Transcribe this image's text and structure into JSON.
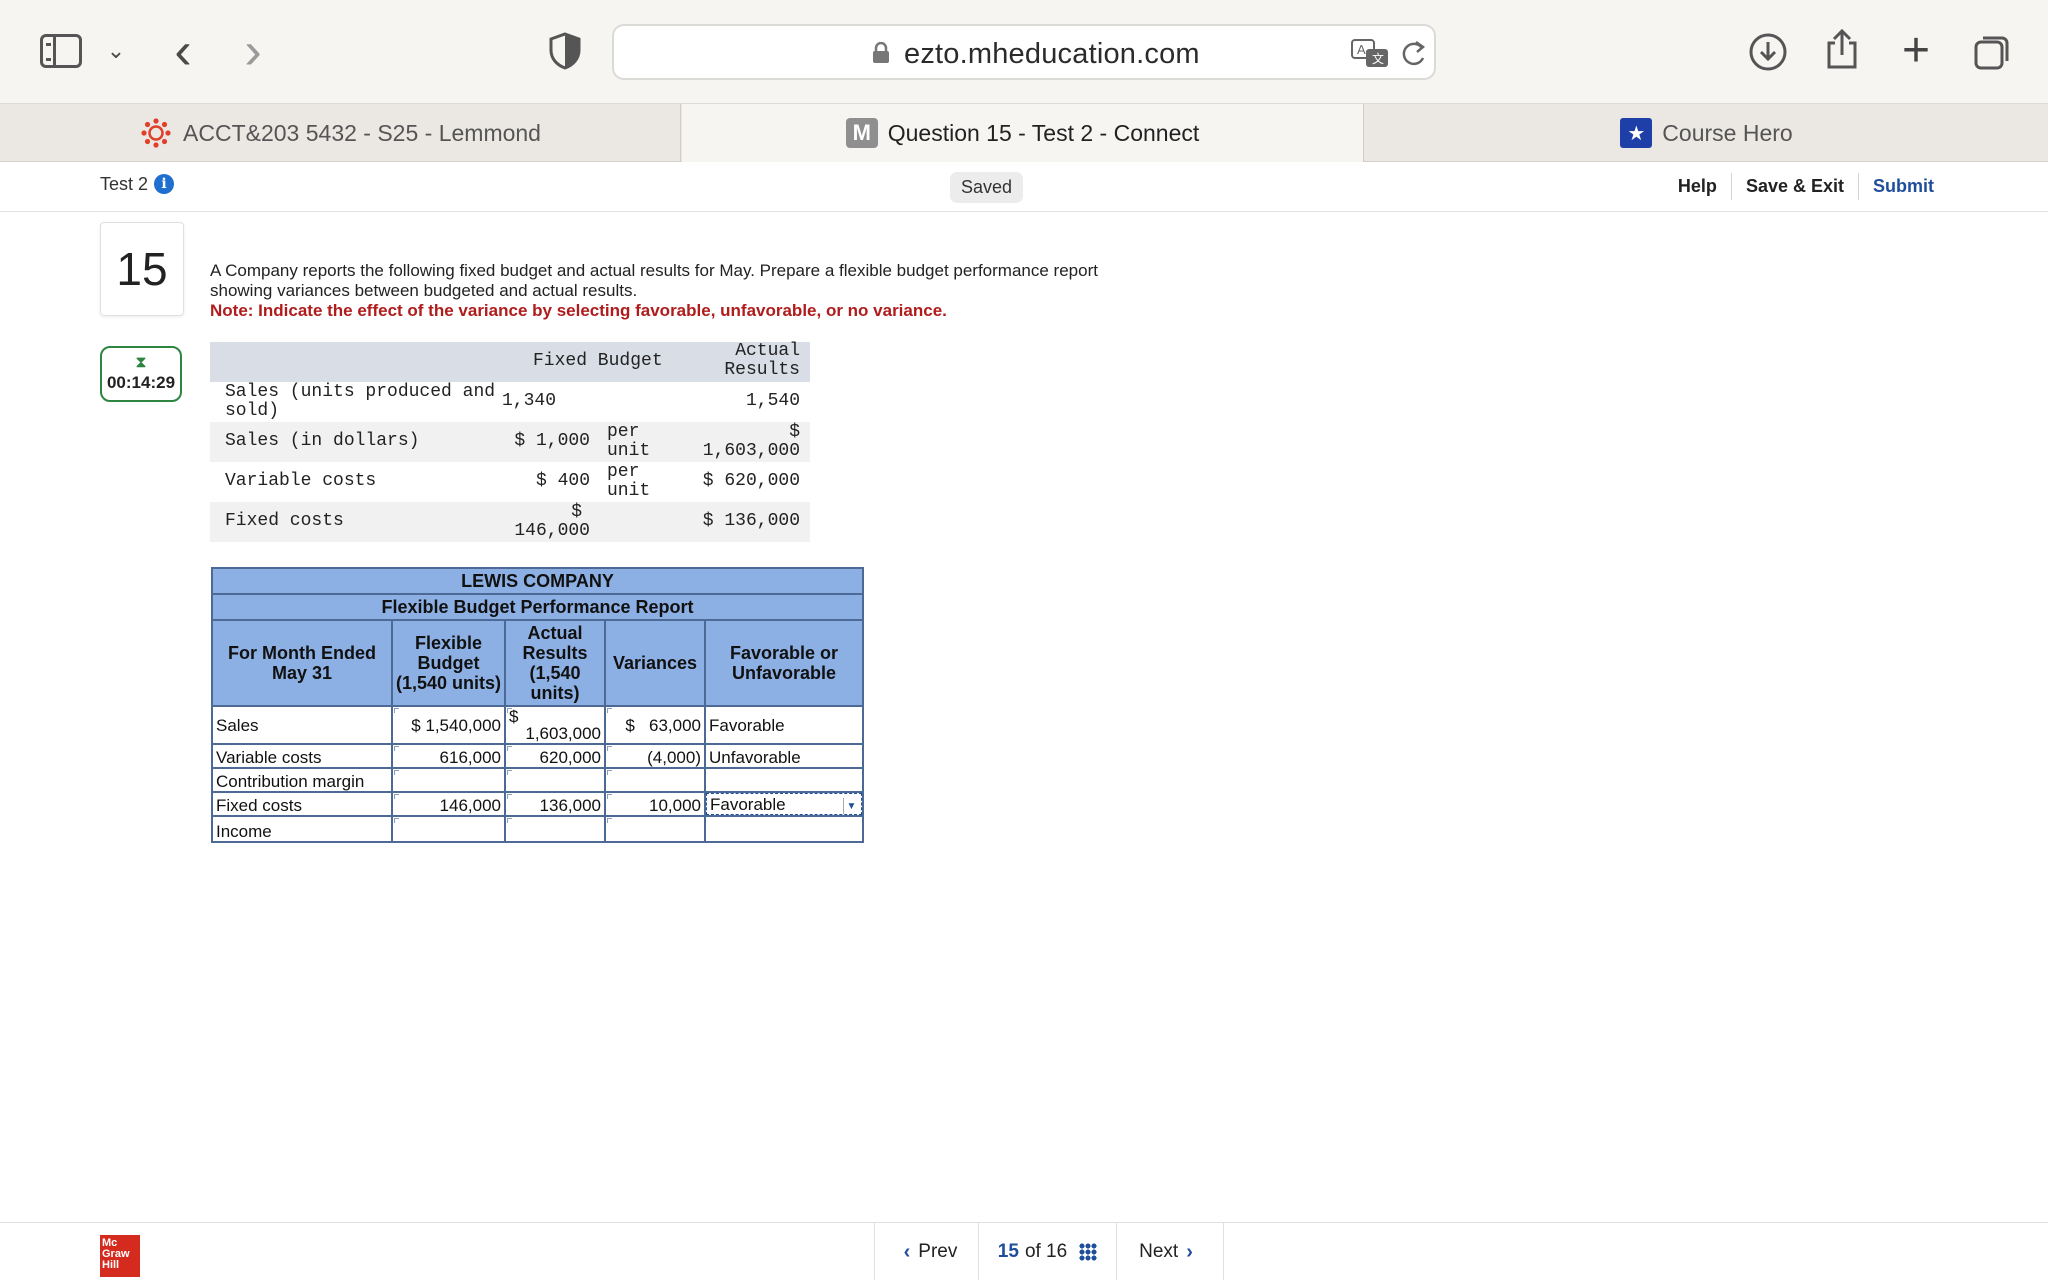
{
  "browser": {
    "url": "ezto.mheducation.com",
    "tabs": [
      {
        "label": "ACCT&203 5432 - S25 - Lemmond"
      },
      {
        "label": "Question 15 - Test 2 - Connect",
        "fav": "M"
      },
      {
        "label": "Course Hero"
      }
    ]
  },
  "header": {
    "test_label": "Test 2",
    "info": "i",
    "saved": "Saved",
    "help": "Help",
    "save_exit": "Save & Exit",
    "submit": "Submit"
  },
  "question": {
    "number": "15",
    "timer": "00:14:29",
    "prompt_line1": "A Company reports the following fixed budget and actual results for May. Prepare a flexible budget performance report",
    "prompt_line2": "showing variances between budgeted and actual results.",
    "note": "Note: Indicate the effect of the variance by selecting favorable, unfavorable, or no variance."
  },
  "given": {
    "headers": {
      "fixed": "Fixed Budget",
      "actual_1": "Actual",
      "actual_2": "Results"
    },
    "rows": [
      {
        "label_1": "Sales (units produced and",
        "label_2": "sold)",
        "fixed": "1,340",
        "per_1": "",
        "per_2": "",
        "actual_1": "",
        "actual_2": "1,540"
      },
      {
        "label_1": "Sales (in dollars)",
        "label_2": "",
        "fixed": "$ 1,000",
        "per_1": "per",
        "per_2": "unit",
        "actual_1": "$",
        "actual_2": "1,603,000"
      },
      {
        "label_1": "Variable costs",
        "label_2": "",
        "fixed": "$ 400",
        "per_1": "per",
        "per_2": "unit",
        "actual_1": "",
        "actual_2": "$ 620,000"
      },
      {
        "label_1": "Fixed costs",
        "label_2": "",
        "fixed_1": "$",
        "fixed": "146,000",
        "per_1": "",
        "per_2": "",
        "actual_1": "",
        "actual_2": "$ 136,000"
      }
    ]
  },
  "report": {
    "company": "LEWIS COMPANY",
    "title": "Flexible Budget Performance Report",
    "col_month": "For Month Ended May 31",
    "col_flex": "Flexible Budget (1,540 units)",
    "col_actual": "Actual Results (1,540 units)",
    "col_var": "Variances",
    "col_fav": "Favorable or Unfavorable",
    "rows": [
      {
        "label": "Sales",
        "flex": "$ 1,540,000",
        "actual_dollar": "$",
        "actual": "1,603,000",
        "var": "$   63,000",
        "fav": "Favorable"
      },
      {
        "label": "Variable costs",
        "flex": "616,000",
        "actual": "620,000",
        "var": "(4,000)",
        "fav": "Unfavorable"
      },
      {
        "label": "Contribution margin",
        "flex": "",
        "actual": "",
        "var": "",
        "fav": ""
      },
      {
        "label": "Fixed costs",
        "flex": "146,000",
        "actual": "136,000",
        "var": "10,000",
        "fav": "Favorable"
      },
      {
        "label": "Income",
        "flex": "",
        "actual": "",
        "var": "",
        "fav": ""
      }
    ]
  },
  "footer": {
    "prev": "Prev",
    "current": "15",
    "of_total": "of 16",
    "next": "Next"
  },
  "colors": {
    "accent": "#1f4e9c",
    "report_header": "#8db0e4",
    "note": "#b01c1c",
    "timer": "#2e8540"
  }
}
